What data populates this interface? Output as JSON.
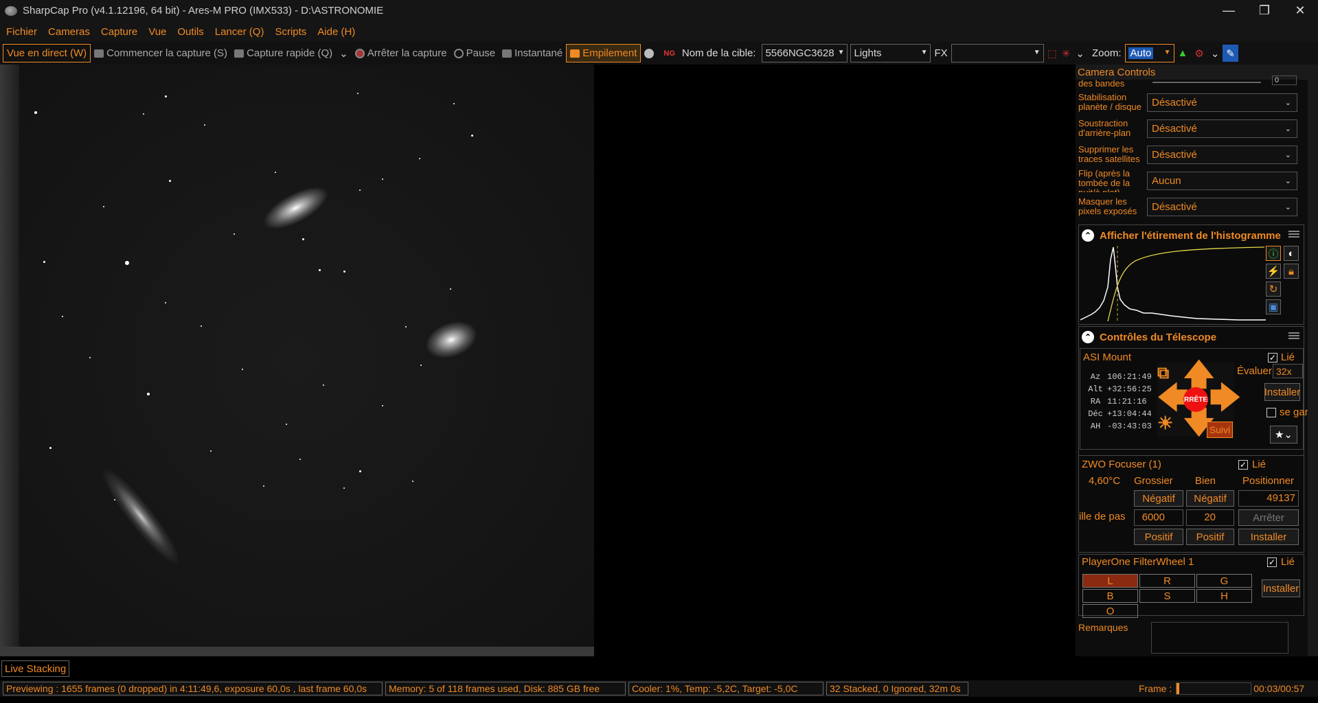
{
  "window": {
    "title": "SharpCap Pro (v4.1.12196, 64 bit) - Ares-M PRO (IMX533) - D:\\ASTRONOMIE",
    "minimize": "—",
    "restore": "❐",
    "close": "✕"
  },
  "menu": [
    "Fichier",
    "Cameras",
    "Capture",
    "Vue",
    "Outils",
    "Lancer (Q)",
    "Scripts",
    "Aide (H)"
  ],
  "toolbar": {
    "live_view": "Vue en direct (W)",
    "start_capture": "Commencer la capture (S)",
    "quick_capture": "Capture rapide (Q)",
    "stop_capture": "Arrêter la capture",
    "pause": "Pause",
    "snapshot": "Instantané",
    "stacking": "Empilement",
    "target_label": "Nom de la cible:",
    "target_value": "5566NGC3628",
    "frame_type": "Lights",
    "fx_label": "FX",
    "fx_value": "",
    "zoom_label": "Zoom:",
    "zoom_value": "Auto"
  },
  "camera_controls": {
    "title": "Camera Controls",
    "partial_label": "des bandes",
    "partial_value": "0",
    "rows": [
      {
        "label": "Stabilisation planète / disque",
        "value": "Désactivé"
      },
      {
        "label": "Soustraction d'arrière-plan",
        "value": "Désactivé"
      },
      {
        "label": "Supprimer les traces satellites",
        "value": "Désactivé"
      },
      {
        "label": "Flip (après la tombée de la nuit/à plat)",
        "value": "Aucun"
      },
      {
        "label": "Masquer les pixels exposés",
        "value": "Désactivé"
      }
    ]
  },
  "histogram": {
    "title": "Afficher l'étirement de l'histogramme"
  },
  "telescope": {
    "title": "Contrôles du Télescope",
    "mount": "ASI Mount",
    "linked": "Lié",
    "evaluate_label": "Évaluer:",
    "evaluate_value": "32x",
    "install": "Installer",
    "park": "se garer",
    "stop": "ARRÊTER",
    "tracking": "Suivi",
    "coords": [
      {
        "k": "Az",
        "v": "106:21:49"
      },
      {
        "k": "Alt",
        "v": "+32:56:25"
      },
      {
        "k": "RA",
        "v": "11:21:16"
      },
      {
        "k": "Déc",
        "v": "+13:04:44"
      },
      {
        "k": "AH",
        "v": "-03:43:03"
      }
    ]
  },
  "focuser": {
    "title": "ZWO Focuser (1)",
    "linked": "Lié",
    "temp": "4,60°C",
    "coarse": "Grossier",
    "fine": "Bien",
    "position_label": "Positionner",
    "position_value": "49137",
    "negative": "Négatif",
    "positive": "Positif",
    "step_label": "ille de pas",
    "coarse_step": "6000",
    "fine_step": "20",
    "stop": "Arrêter",
    "install": "Installer"
  },
  "filterwheel": {
    "title": "PlayerOne FilterWheel 1",
    "linked": "Lié",
    "filters": [
      "L",
      "R",
      "G",
      "B",
      "S",
      "H",
      "O"
    ],
    "install": "Installer"
  },
  "notes": {
    "label": "Remarques"
  },
  "live_tab": "Live Stacking",
  "status": {
    "preview": "Previewing : 1655 frames (0 dropped) in 4:11:49,6, exposure 60,0s , last frame 60,0s",
    "memory": "Memory: 5 of 118 frames used, Disk: 885 GB free",
    "cooler": "Cooler: 1%, Temp: -5,2C, Target: -5,0C",
    "stacked": "32 Stacked, 0 Ignored, 32m 0s",
    "frame_label": "Frame :",
    "time": "00:03/00:57"
  }
}
